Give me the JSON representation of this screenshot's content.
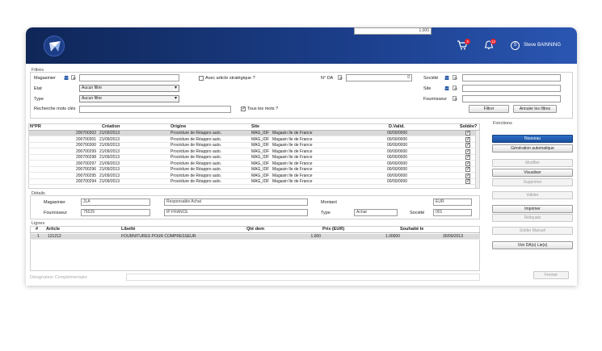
{
  "header": {
    "cart_badge": "3",
    "bell_badge": "12",
    "user_initial": "S",
    "user_name": "Steve BAINNING"
  },
  "filters": {
    "title": "Filtres",
    "magasinier_label": "Magasinier",
    "magasinier_value": "",
    "strategic_label": "Avec article stratégique ?",
    "nda_label": "N° DA",
    "nda_value": "0",
    "societe_label": "Société",
    "etat_label": "Etat",
    "etat_value": "Aucun filtre",
    "site_label": "Site",
    "type_label": "Type",
    "type_value": "Aucun filtre",
    "fournisseur_label": "Fournisseur",
    "search_label": "Recherche mots clés",
    "all_words_label": "Tous les mots ?",
    "filter_button": "Filtrer",
    "clear_button": "Annuler les filtres"
  },
  "grid": {
    "columns": [
      "N°PR",
      "Création",
      "Origine",
      "Site",
      "D.Valid.",
      "Soldée?"
    ],
    "rows": [
      [
        "200700302",
        "21/09/2013",
        "Procédure de Réappro auto.",
        "MAG_IDF",
        "Magasin Ile de France",
        "00/00/0000"
      ],
      [
        "200700301",
        "21/09/2013",
        "Procédure de Réappro auto.",
        "MAG_IDF",
        "Magasin Ile de France",
        "00/00/0000"
      ],
      [
        "200700300",
        "21/09/2013",
        "Procédure de Réappro auto.",
        "MAG_IDF",
        "Magasin Ile de France",
        "00/00/0000"
      ],
      [
        "200700299",
        "21/09/2013",
        "Procédure de Réappro auto.",
        "MAG_IDF",
        "Magasin Ile de France",
        "00/00/0000"
      ],
      [
        "200700298",
        "21/09/2013",
        "Procédure de Réappro auto.",
        "MAG_IDF",
        "Magasin Ile de France",
        "00/00/0000"
      ],
      [
        "200700297",
        "21/09/2013",
        "Procédure de Réappro auto.",
        "MAG_IDF",
        "Magasin Ile de France",
        "00/00/0000"
      ],
      [
        "200700296",
        "21/09/2013",
        "Procédure de Réappro auto.",
        "MAG_IDF",
        "Magasin Ile de France",
        "00/00/0000"
      ],
      [
        "200700295",
        "21/09/2013",
        "Procédure de Réappro auto.",
        "MAG_IDF",
        "Magasin Ile de France",
        "00/00/0000"
      ],
      [
        "200700294",
        "21/09/2013",
        "Procédure de Réappro auto.",
        "MAG_IDF",
        "Magasin Ile de France",
        "00/00/0000"
      ]
    ]
  },
  "functions": {
    "title": "Fonctions",
    "nouveau": "Nouveau",
    "generation": "Génération automatique",
    "modifier": "Modifier",
    "visualiser": "Visualiser",
    "supprimer": "Supprimer",
    "valider": "Valider",
    "imprimer": "Imprimer",
    "reliquats": "Reliquats",
    "solder": "Solder Manuel",
    "voir_da": "Voir DA(s) Lie(s)",
    "fermer": "Fermer"
  },
  "details": {
    "title": "Détails",
    "magasinier_label": "Magasinier",
    "magasinier_code": "JLA",
    "magasinier_name": "Responsable Achat",
    "montant_label": "Montant",
    "montant_value": "1.000",
    "currency": "EUR",
    "fournisseur_label": "Fournisseur",
    "fournisseur_code": "75529",
    "fournisseur_name": "IP FRANCE",
    "type_label": "Type",
    "type_value": "Achat",
    "societe_label": "Société",
    "societe_value": "001"
  },
  "lines": {
    "title": "Lignes",
    "columns": [
      "#",
      "Article",
      "Libellé",
      "Qté dem",
      "Prix (EUR)",
      "Souhaité le"
    ],
    "rows": [
      [
        "1",
        "121212",
        "FOURNITURES POUR COMPRESSEUR",
        "1.000",
        "1.00000",
        "30/09/2013"
      ]
    ]
  },
  "footer": {
    "designation_label": "Désignation Complémentaire"
  }
}
